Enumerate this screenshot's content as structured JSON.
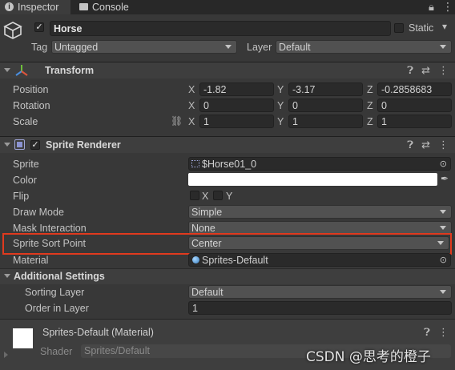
{
  "tabs": [
    {
      "label": "Inspector",
      "icon": "info-icon"
    },
    {
      "label": "Console",
      "icon": "console-icon"
    }
  ],
  "gameobject": {
    "name": "Horse",
    "static_label": "Static",
    "tag_label": "Tag",
    "tag_value": "Untagged",
    "layer_label": "Layer",
    "layer_value": "Default"
  },
  "transform": {
    "title": "Transform",
    "rows": [
      {
        "label": "Position",
        "x": "-1.82",
        "y": "-3.17",
        "z": "-0.2858683"
      },
      {
        "label": "Rotation",
        "x": "0",
        "y": "0",
        "z": "0"
      },
      {
        "label": "Scale",
        "x": "1",
        "y": "1",
        "z": "1"
      }
    ],
    "axis_x": "X",
    "axis_y": "Y",
    "axis_z": "Z"
  },
  "sprite_renderer": {
    "title": "Sprite Renderer",
    "sprite_label": "Sprite",
    "sprite_value": "$Horse01_0",
    "color_label": "Color",
    "color_value": "#ffffff",
    "flip_label": "Flip",
    "flip_x": "X",
    "flip_y": "Y",
    "draw_mode_label": "Draw Mode",
    "draw_mode_value": "Simple",
    "mask_label": "Mask Interaction",
    "mask_value": "None",
    "sort_point_label": "Sprite Sort Point",
    "sort_point_value": "Center",
    "material_label": "Material",
    "material_value": "Sprites-Default"
  },
  "additional": {
    "title": "Additional Settings",
    "sorting_layer_label": "Sorting Layer",
    "sorting_layer_value": "Default",
    "order_label": "Order in Layer",
    "order_value": "1"
  },
  "material_section": {
    "name": "Sprites-Default (Material)",
    "shader_label": "Shader",
    "shader_value": "Sprites/Default"
  },
  "watermark": "CSDN @思考的橙子",
  "colors": {
    "highlight_border": "#e03a1e",
    "background": "#383838"
  }
}
